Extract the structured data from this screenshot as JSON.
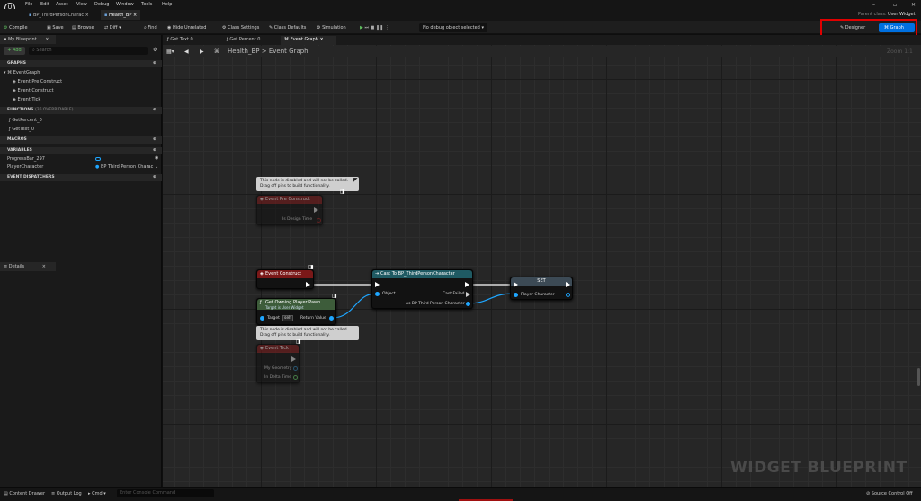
{
  "menu": [
    "File",
    "Edit",
    "Asset",
    "View",
    "Debug",
    "Window",
    "Tools",
    "Help"
  ],
  "tabs": {
    "tab1": "BP_ThirdPersonCharac",
    "tab2": "Health_BP"
  },
  "parent_class": {
    "label": "Parent class:",
    "value": "User Widget"
  },
  "toolbar": {
    "compile": "Compile",
    "save": "Save",
    "browse": "Browse",
    "diff": "Diff",
    "find": "Find",
    "hide_unrelated": "Hide Unrelated",
    "class_settings": "Class Settings",
    "class_defaults": "Class Defaults",
    "simulation": "Simulation",
    "debug_object": "No debug object selected",
    "designer": "Designer",
    "graph": "Graph"
  },
  "my_blueprint": {
    "title": "My Blueprint",
    "add": "+ Add",
    "search_placeholder": "Search",
    "graphs_header": "GRAPHS",
    "event_graph": "EventGraph",
    "events": [
      "Event Pre Construct",
      "Event Construct",
      "Event Tick"
    ],
    "functions_header": "FUNCTIONS",
    "functions_note": "(36 OVERRIDABLE)",
    "functions": [
      "GetPercent_0",
      "GetText_0"
    ],
    "macros_header": "MACROS",
    "variables_header": "VARIABLES",
    "variables": [
      {
        "name": "ProgressBar_297",
        "type": ""
      },
      {
        "name": "PlayerCharacter",
        "type": "BP Third Person Charac"
      }
    ],
    "dispatchers_header": "EVENT DISPATCHERS"
  },
  "details": {
    "title": "Details"
  },
  "graph_tabs": [
    "Get Text 0",
    "Get Percent 0",
    "Event Graph"
  ],
  "breadcrumb": {
    "root": "Health_BP",
    "sep": ">",
    "current": "Event Graph"
  },
  "zoom": "Zoom 1:1",
  "watermark": "WIDGET BLUEPRINT",
  "nodes": {
    "pre_construct": {
      "comment": "This node is disabled and will not be called. Drag off pins to build functionality.",
      "title": "Event Pre Construct",
      "pin": "Is Design Time"
    },
    "construct": {
      "title": "Event Construct"
    },
    "get_player": {
      "title": "Get Owning Player Pawn",
      "subtitle": "Target is User Widget",
      "target": "Target",
      "self": "self",
      "ret": "Return Value"
    },
    "cast": {
      "title": "Cast To BP_ThirdPersonCharacter",
      "object": "Object",
      "failed": "Cast Failed",
      "as": "As BP Third Person Character"
    },
    "set": {
      "title": "SET",
      "pin": "Player Character"
    },
    "tick": {
      "comment": "This node is disabled and will not be called. Drag off pins to build functionality.",
      "title": "Event Tick",
      "geom": "My Geometry",
      "delta": "In Delta Time"
    }
  },
  "bottom": {
    "content_drawer": "Content Drawer",
    "output_log": "Output Log",
    "cmd": "Cmd",
    "console_placeholder": "Enter Console Command",
    "source_control": "Source Control Off"
  },
  "colors": {
    "accent": "#0070e0",
    "event_red": "#7a1818",
    "cast_teal": "#1f5a63",
    "set_slate": "#3c4a55",
    "get_green": "#3d5c3a",
    "highlight": "#e00000"
  }
}
